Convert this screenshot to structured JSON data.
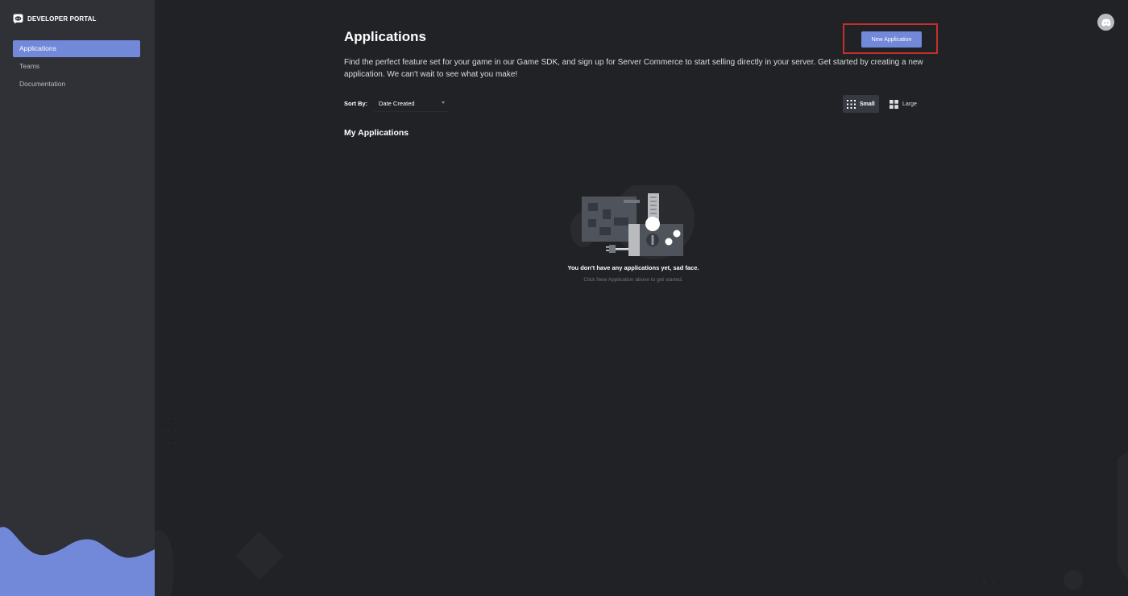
{
  "brand": {
    "title": "DEVELOPER PORTAL",
    "logo_icon": "discord-logo-icon"
  },
  "sidebar": {
    "items": [
      {
        "label": "Applications",
        "active": true
      },
      {
        "label": "Teams",
        "active": false
      },
      {
        "label": "Documentation",
        "active": false
      }
    ]
  },
  "header": {
    "title": "Applications",
    "new_app_label": "New Application",
    "description": "Find the perfect feature set for your game in our Game SDK, and sign up for Server Commerce to start selling directly in your server. Get started by creating a new application. We can't wait to see what you make!"
  },
  "sort": {
    "label": "Sort By:",
    "selected": "Date Created"
  },
  "view": {
    "small_label": "Small",
    "large_label": "Large",
    "selected": "Small"
  },
  "section": {
    "title": "My Applications"
  },
  "empty_state": {
    "title": "You don't have any applications yet, sad face.",
    "subtitle": "Click New Application above to get started."
  },
  "user": {
    "avatar_icon": "discord-avatar-icon"
  },
  "colors": {
    "accent": "#7289da",
    "sidebar_bg": "#2f3136",
    "main_bg": "#202225",
    "highlight": "#c4302b"
  }
}
